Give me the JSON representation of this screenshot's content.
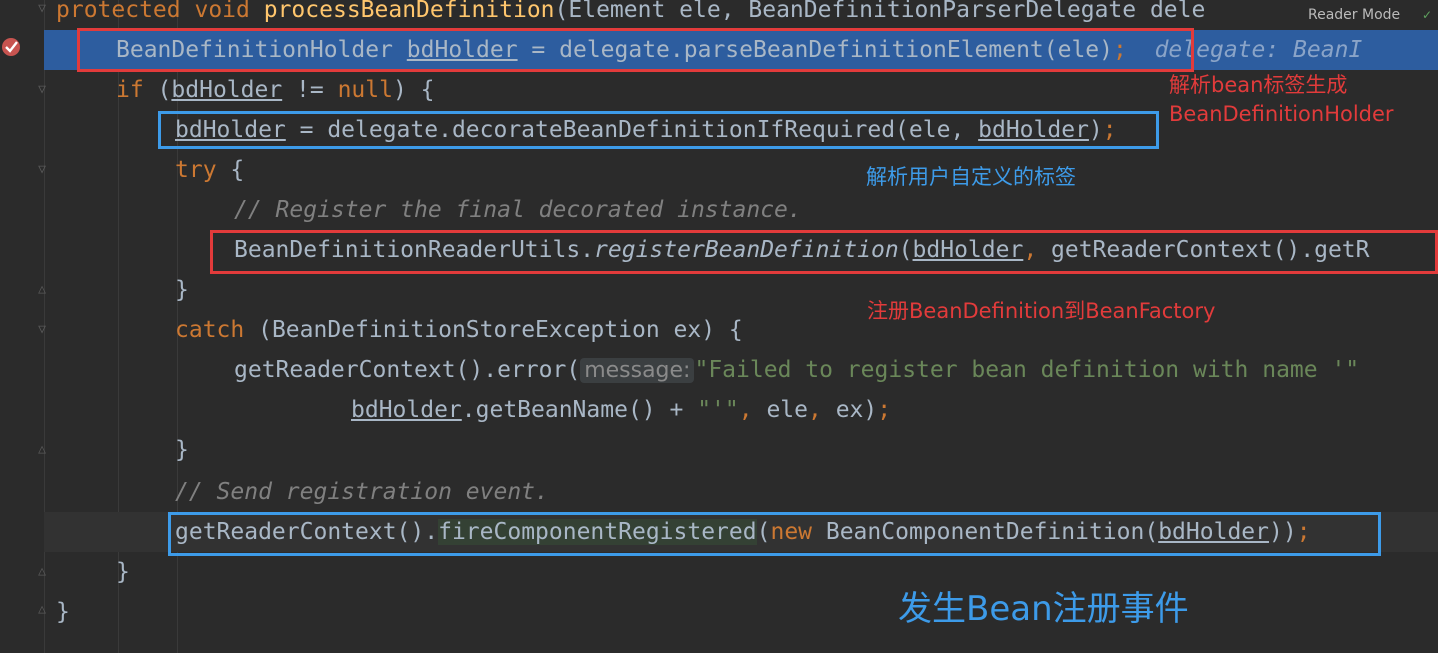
{
  "code": {
    "l0": {
      "kw1": "protected",
      "kw2": "void",
      "method": "processBeanDefinition",
      "rest": "(Element ele, BeanDefinitionParserDelegate dele"
    },
    "l1": {
      "type": "BeanDefinitionHolder ",
      "var": "bdHolder",
      "rest": " = delegate.parseBeanDefinitionElement(ele)",
      "semi": ";",
      "inline": "delegate: BeanI"
    },
    "l2": {
      "kw": "if",
      "rest1": " (",
      "var": "bdHolder",
      "rest2": " != ",
      "kw_null": "null",
      "rest3": ") {"
    },
    "l3": {
      "var": "bdHolder",
      "rest": " = delegate.decorateBeanDefinitionIfRequired(ele, ",
      "var2": "bdHolder",
      "rest2": ")",
      "semi": ";"
    },
    "l4": {
      "kw": "try",
      "rest": " {"
    },
    "l5": {
      "comment": "// Register the final decorated instance."
    },
    "l6": {
      "cls": "BeanDefinitionReaderUtils.",
      "method": "registerBeanDefinition",
      "p1": "(",
      "var": "bdHolder",
      "comma": ",",
      "rest": " getReaderContext().getR"
    },
    "l7": {
      "text": "}"
    },
    "l8": {
      "kw": "catch",
      "rest": " (BeanDefinitionStoreException ex) {"
    },
    "l9": {
      "pre": "getReaderContext().error(",
      "hint": "message:",
      "str": "\"Failed to register bean definition with name '\""
    },
    "l10": {
      "var": "bdHolder",
      "rest1": ".getBeanName() + ",
      "str": "\"'\"",
      "comma1": ",",
      "rest2": " ele",
      "comma2": ",",
      "rest3": " ex)",
      "semi": ";"
    },
    "l11": {
      "text": "}"
    },
    "l12": {
      "comment": "// Send registration event."
    },
    "l13": {
      "pre": "getReaderContext().",
      "fn": "fireComponentRegistered",
      "p": "(",
      "kw": "new",
      "rest1": " BeanComponentDefinition(",
      "var": "bdHolder",
      "rest2": "))",
      "semi": ";"
    },
    "l14": {
      "text": "}"
    },
    "l15": {
      "text": "}"
    }
  },
  "annotations": {
    "a1_line1": "解析bean标签生成",
    "a1_line2": "BeanDefinitionHolder",
    "a2": "解析用户自定义的标签",
    "a3": "注册BeanDefinition到BeanFactory",
    "a4": "发生Bean注册事件"
  },
  "toolbar": {
    "reader_mode": "Reader Mode"
  },
  "colors": {
    "keyword": "#cc7832",
    "comment": "#808080",
    "string": "#6a8759",
    "method": "#ffc66d",
    "text": "#a9b7c6",
    "exec_line": "#2d5d9f",
    "annot_red": "#e23b3b",
    "annot_blue": "#3d9be9"
  }
}
